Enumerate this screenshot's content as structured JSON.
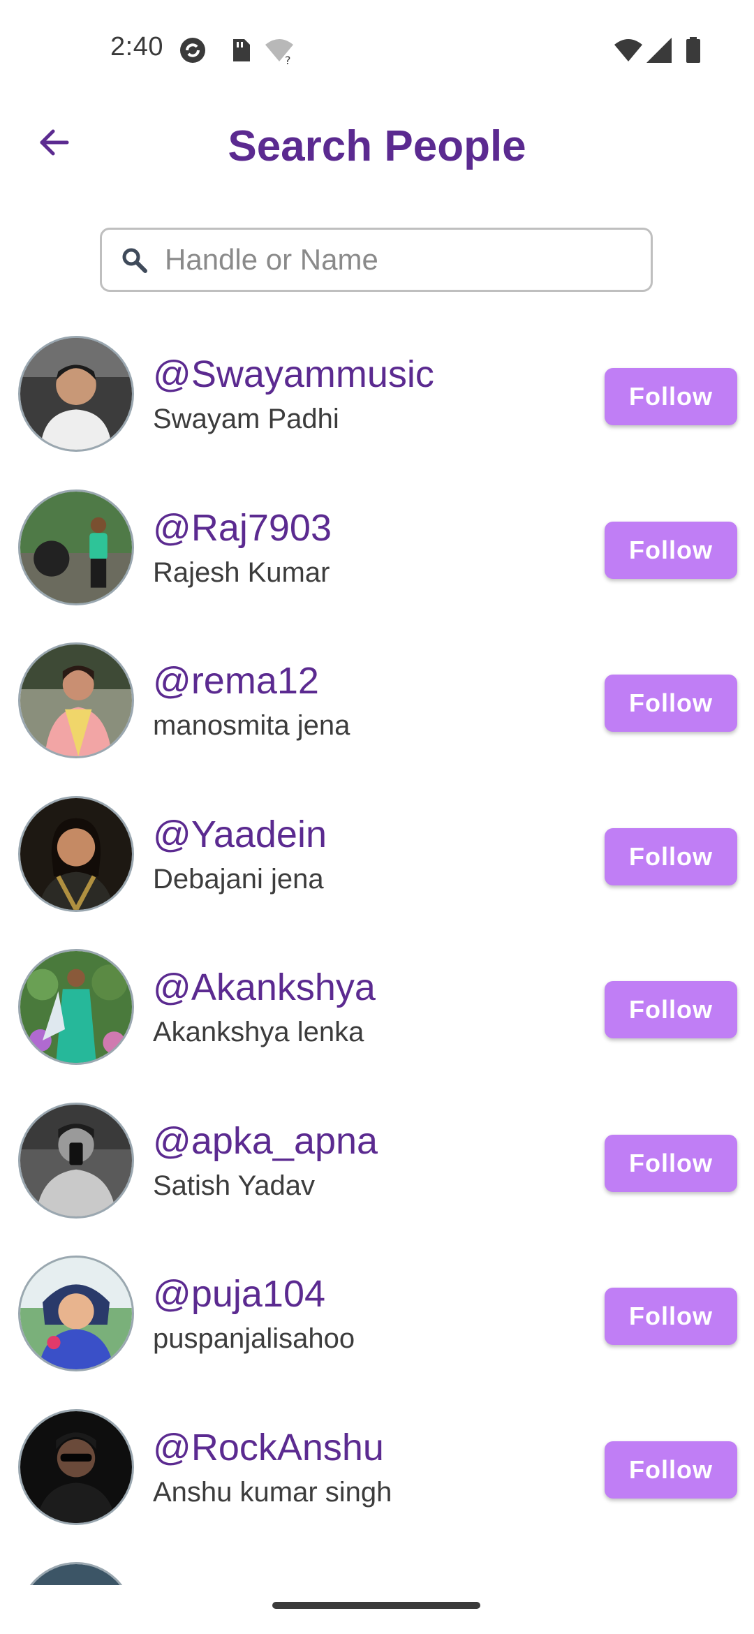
{
  "status_bar": {
    "time": "2:40"
  },
  "header": {
    "title": "Search People",
    "back_icon": "arrow-left-icon"
  },
  "search": {
    "placeholder": "Handle or Name",
    "value": ""
  },
  "colors": {
    "title": "#5b2a90",
    "handle": "#5b2a90",
    "follow_button": "#c07ef5",
    "follow_text": "#ffffff"
  },
  "people": [
    {
      "handle": "@Swayammusic",
      "name": "Swayam Padhi",
      "button": "Follow"
    },
    {
      "handle": "@Raj7903",
      "name": "Rajesh Kumar",
      "button": "Follow"
    },
    {
      "handle": "@rema12",
      "name": "manosmita jena",
      "button": "Follow"
    },
    {
      "handle": "@Yaadein",
      "name": "Debajani jena",
      "button": "Follow"
    },
    {
      "handle": "@Akankshya",
      "name": "Akankshya lenka",
      "button": "Follow"
    },
    {
      "handle": "@apka_apna",
      "name": "Satish Yadav",
      "button": "Follow"
    },
    {
      "handle": "@puja104",
      "name": "puspanjalisahoo",
      "button": "Follow"
    },
    {
      "handle": "@RockAnshu",
      "name": "Anshu kumar singh",
      "button": "Follow"
    }
  ]
}
